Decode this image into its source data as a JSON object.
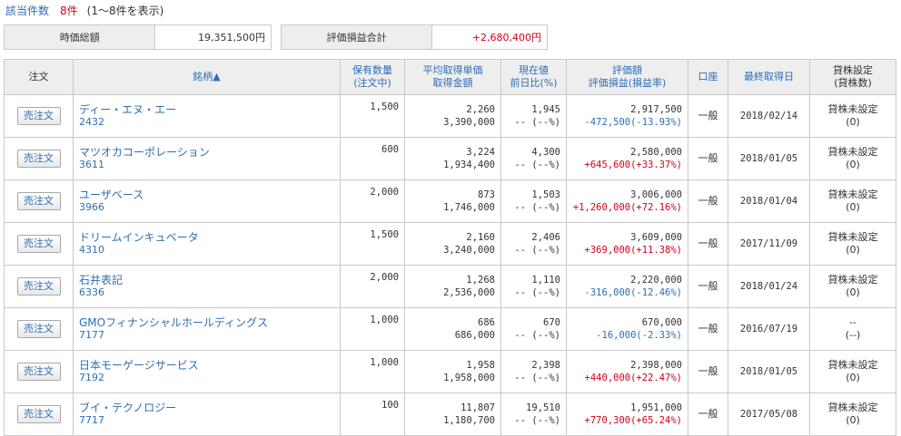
{
  "summary": {
    "count_label": "該当件数",
    "count_value": "8件",
    "count_range": "(1～8件を表示)",
    "market_value_label": "時価総額",
    "market_value": "19,351,500円",
    "pl_total_label": "評価損益合計",
    "pl_total": "+2,680,400円"
  },
  "columns": {
    "order": "注文",
    "name": "銘柄▲",
    "qty_1": "保有数量",
    "qty_2": "(注文中)",
    "avg_1": "平均取得単価",
    "avg_2": "取得金額",
    "price_1": "現在値",
    "price_2": "前日比(%)",
    "val_1": "評価額",
    "val_2": "評価損益(損益率)",
    "account": "口座",
    "last_date": "最終取得日",
    "lend_1": "貸株設定",
    "lend_2": "(貸株数)"
  },
  "rows": [
    {
      "button": "売注文",
      "name": "ディー・エヌ・エー",
      "code": "2432",
      "qty": "1,500",
      "avg_price": "2,260",
      "cost": "3,390,000",
      "price": "1,945",
      "change": "-- (--%)",
      "value": "2,917,500",
      "pl": "-472,500(-13.93%)",
      "pl_sign": "neg",
      "account": "一般",
      "date": "2018/02/14",
      "lend_1": "貸株未設定",
      "lend_2": "(0)"
    },
    {
      "button": "売注文",
      "name": "マツオカコーポレーション",
      "code": "3611",
      "qty": "600",
      "avg_price": "3,224",
      "cost": "1,934,400",
      "price": "4,300",
      "change": "-- (--%)",
      "value": "2,580,000",
      "pl": "+645,600(+33.37%)",
      "pl_sign": "pos",
      "account": "一般",
      "date": "2018/01/05",
      "lend_1": "貸株未設定",
      "lend_2": "(0)"
    },
    {
      "button": "売注文",
      "name": "ユーザベース",
      "code": "3966",
      "qty": "2,000",
      "avg_price": "873",
      "cost": "1,746,000",
      "price": "1,503",
      "change": "-- (--%)",
      "value": "3,006,000",
      "pl": "+1,260,000(+72.16%)",
      "pl_sign": "pos",
      "account": "一般",
      "date": "2018/01/04",
      "lend_1": "貸株未設定",
      "lend_2": "(0)"
    },
    {
      "button": "売注文",
      "name": "ドリームインキュベータ",
      "code": "4310",
      "qty": "1,500",
      "avg_price": "2,160",
      "cost": "3,240,000",
      "price": "2,406",
      "change": "-- (--%)",
      "value": "3,609,000",
      "pl": "+369,000(+11.38%)",
      "pl_sign": "pos",
      "account": "一般",
      "date": "2017/11/09",
      "lend_1": "貸株未設定",
      "lend_2": "(0)"
    },
    {
      "button": "売注文",
      "name": "石井表記",
      "code": "6336",
      "qty": "2,000",
      "avg_price": "1,268",
      "cost": "2,536,000",
      "price": "1,110",
      "change": "-- (--%)",
      "value": "2,220,000",
      "pl": "-316,000(-12.46%)",
      "pl_sign": "neg",
      "account": "一般",
      "date": "2018/01/24",
      "lend_1": "貸株未設定",
      "lend_2": "(0)"
    },
    {
      "button": "売注文",
      "name": "GMOフィナンシャルホールディングス",
      "code": "7177",
      "qty": "1,000",
      "avg_price": "686",
      "cost": "686,000",
      "price": "670",
      "change": "-- (--%)",
      "value": "670,000",
      "pl": "-16,000(-2.33%)",
      "pl_sign": "neg",
      "account": "一般",
      "date": "2016/07/19",
      "lend_1": "--",
      "lend_2": "(--)"
    },
    {
      "button": "売注文",
      "name": "日本モーゲージサービス",
      "code": "7192",
      "qty": "1,000",
      "avg_price": "1,958",
      "cost": "1,958,000",
      "price": "2,398",
      "change": "-- (--%)",
      "value": "2,398,000",
      "pl": "+440,000(+22.47%)",
      "pl_sign": "pos",
      "account": "一般",
      "date": "2018/01/05",
      "lend_1": "貸株未設定",
      "lend_2": "(0)"
    },
    {
      "button": "売注文",
      "name": "ブイ・テクノロジー",
      "code": "7717",
      "qty": "100",
      "avg_price": "11,807",
      "cost": "1,180,700",
      "price": "19,510",
      "change": "-- (--%)",
      "value": "1,951,000",
      "pl": "+770,300(+65.24%)",
      "pl_sign": "pos",
      "account": "一般",
      "date": "2017/05/08",
      "lend_1": "貸株未設定",
      "lend_2": "(0)"
    }
  ],
  "colors": {
    "positive": "#d0021b",
    "negative": "#2d6db5",
    "link": "#2d6db5",
    "header_bg": "#eeeeee"
  }
}
